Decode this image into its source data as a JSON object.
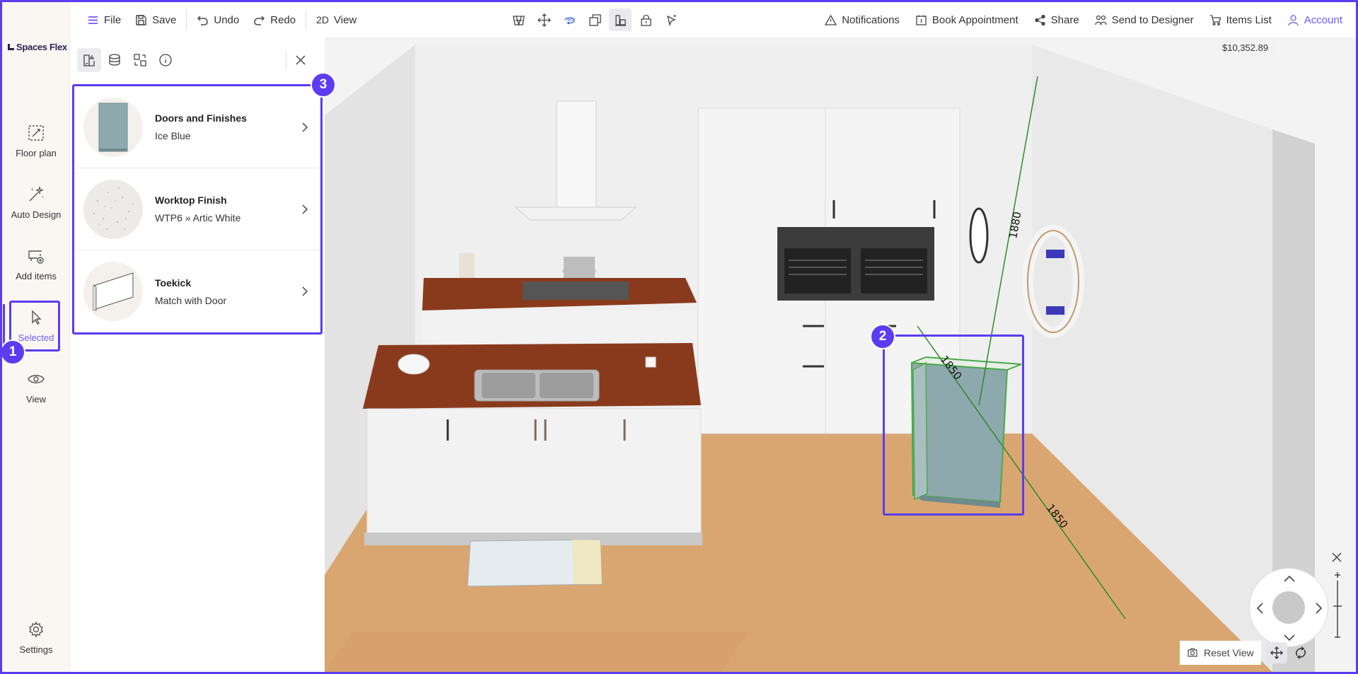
{
  "sidebar": {
    "logo": "Spaces Flex",
    "items": [
      {
        "label": "Floor plan",
        "icon": "floor-plan-icon"
      },
      {
        "label": "Auto Design",
        "icon": "magic-wand-icon"
      },
      {
        "label": "Add items",
        "icon": "add-items-icon"
      },
      {
        "label": "Selected",
        "icon": "cursor-icon",
        "active": true
      },
      {
        "label": "View",
        "icon": "eye-icon"
      },
      {
        "label": "Settings",
        "icon": "gear-icon"
      }
    ]
  },
  "toolbar": {
    "file": "File",
    "save": "Save",
    "undo": "Undo",
    "redo": "Redo",
    "view_mode": "2D",
    "view": "View",
    "tools": [
      "wireframe-icon",
      "move-icon",
      "rotate-360-icon",
      "duplicate-icon",
      "align-icon",
      "lock-icon",
      "select-cursor-icon"
    ],
    "notifications": "Notifications",
    "book": "Book Appointment",
    "share": "Share",
    "send": "Send to Designer",
    "items": "Items List",
    "account": "Account",
    "price": "$10,352.89"
  },
  "panel": {
    "tabs": [
      "cabinet-properties-icon",
      "material-icon",
      "swap-icon",
      "info-icon"
    ],
    "options": [
      {
        "title": "Doors and Finishes",
        "value": "Ice Blue"
      },
      {
        "title": "Worktop Finish",
        "value": "WTP6 » Artic White"
      },
      {
        "title": "Toekick",
        "value": "Match with Door"
      }
    ]
  },
  "scene": {
    "dimensions": [
      "1880",
      "1850",
      "1850"
    ],
    "reset": "Reset View"
  },
  "badges": [
    "1",
    "2",
    "3"
  ],
  "colors": {
    "accent": "#5b3cf0",
    "selection": "#6c5cf6",
    "cabinet": "#8ea9ad",
    "worktop": "#8a3a1c",
    "floor": "#d9a672"
  }
}
